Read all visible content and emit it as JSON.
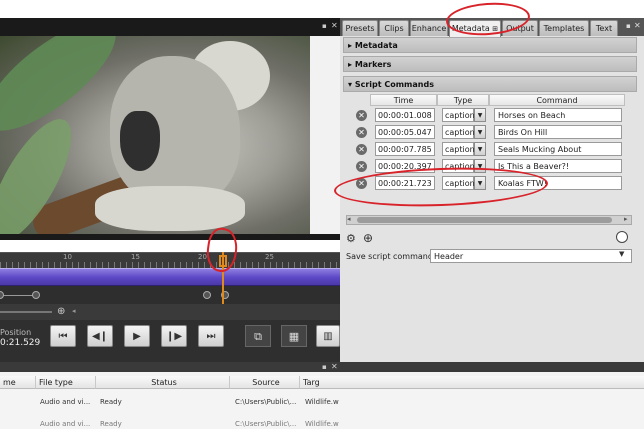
{
  "left_panel": {
    "timeline_ticks": [
      "10",
      "15",
      "20",
      "25"
    ],
    "position_label": "Position",
    "position_value": "0:21.529"
  },
  "right_panel": {
    "tabs": [
      "Presets",
      "Clips",
      "Enhance",
      "Metadata",
      "Output",
      "Templates",
      "Text"
    ],
    "active_tab": "Metadata",
    "sections": {
      "metadata": "Metadata",
      "markers": "Markers",
      "script_commands": "Script Commands"
    },
    "columns": {
      "time": "Time",
      "type": "Type",
      "command": "Command"
    },
    "script_commands": [
      {
        "time": "00:00:01.008",
        "type": "caption",
        "command": "Horses on Beach"
      },
      {
        "time": "00:00:05.047",
        "type": "caption",
        "command": "Birds On Hill"
      },
      {
        "time": "00:00:07.785",
        "type": "caption",
        "command": "Seals Mucking About"
      },
      {
        "time": "00:00:20.397",
        "type": "caption",
        "command": "Is This a Beaver?!"
      },
      {
        "time": "00:00:21.723",
        "type": "caption",
        "command": "Koalas FTW!"
      }
    ],
    "save_label": "Save script commands in",
    "save_value": "Header"
  },
  "bottom_panel": {
    "columns": [
      "me",
      "File type",
      "Status",
      "Source",
      "Targ"
    ],
    "rows": [
      {
        "file_type": "Audio and vi...",
        "status": "Ready",
        "source": "C:\\Users\\Public\\...",
        "target": "Wildlife.w"
      },
      {
        "file_type": "Audio and vi...",
        "status": "Ready",
        "source": "C:\\Users\\Public\\...",
        "target": "Wildlife.w"
      }
    ]
  }
}
